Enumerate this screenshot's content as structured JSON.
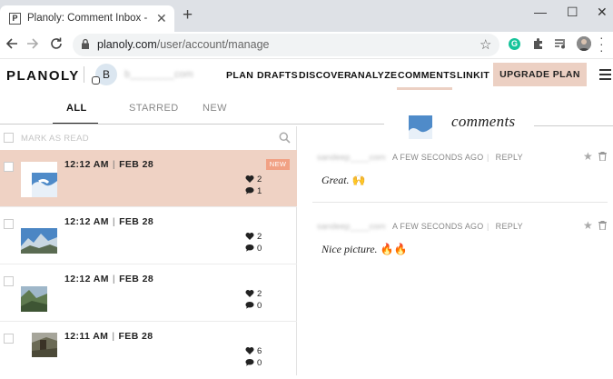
{
  "browser": {
    "tab_title": "Planoly: Comment Inbox - Manage",
    "favicon_letter": "P",
    "url_host": "planoly.com",
    "url_path": "/user/account/manage",
    "extension_g": "G"
  },
  "nav": {
    "brand": "PLANOLY",
    "avatar_letter": "B",
    "account_name": "b________com",
    "links": [
      "PLAN",
      "DRAFTS",
      "DISCOVER",
      "ANALYZE",
      "COMMENTS",
      "LINKIT"
    ],
    "active_link": "COMMENTS",
    "upgrade_label": "UPGRADE PLAN"
  },
  "filters": {
    "tabs": [
      "ALL",
      "STARRED",
      "NEW"
    ],
    "active": "ALL"
  },
  "list": {
    "mark_read_label": "MARK AS READ",
    "rows": [
      {
        "time": "12:12 AM",
        "date": "FEB 28",
        "likes": "2",
        "comments": "1",
        "badge": "NEW",
        "active": true
      },
      {
        "time": "12:12 AM",
        "date": "FEB 28",
        "likes": "2",
        "comments": "0"
      },
      {
        "time": "12:12 AM",
        "date": "FEB 28",
        "likes": "2",
        "comments": "0"
      },
      {
        "time": "12:11 AM",
        "date": "FEB 28",
        "likes": "6",
        "comments": "0"
      }
    ]
  },
  "comments": {
    "title": "comments",
    "items": [
      {
        "user": "sandeep____com",
        "time": "A FEW SECONDS AGO",
        "reply": "REPLY",
        "text": "Great.",
        "emoji": "🙌"
      },
      {
        "user": "sandeep____com",
        "time": "A FEW SECONDS AGO",
        "reply": "REPLY",
        "text": "Nice picture.",
        "emoji": "🔥🔥"
      }
    ]
  },
  "colors": {
    "accent": "#efd2c4",
    "badge": "#f1a184",
    "upgrade": "#ecd0c3"
  },
  "icons": [
    "back-icon",
    "forward-icon",
    "reload-icon",
    "lock-icon",
    "star-icon",
    "puzzle-icon",
    "media-icon",
    "search-icon",
    "heart-icon",
    "comment-icon",
    "trash-icon",
    "instagram-icon"
  ]
}
